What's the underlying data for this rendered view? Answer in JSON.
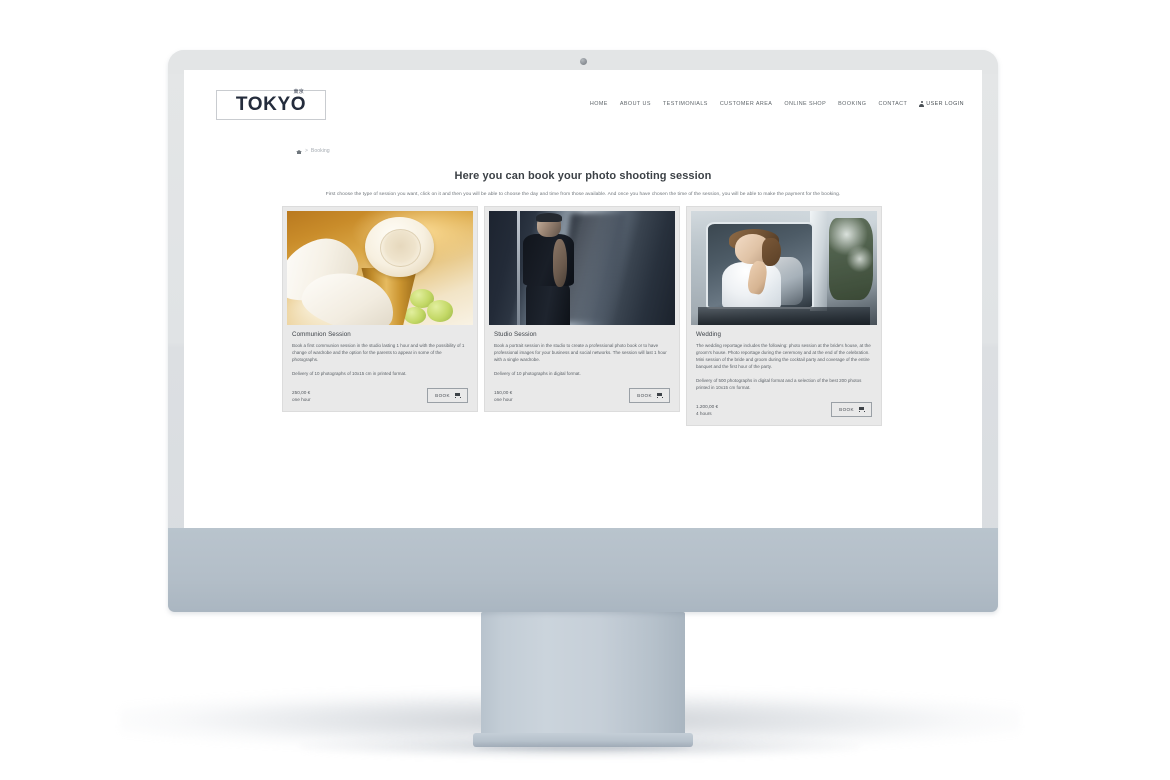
{
  "site": {
    "logo_text": "TOKYO",
    "logo_sub": "東京"
  },
  "nav": {
    "items": [
      {
        "label": "HOME"
      },
      {
        "label": "ABOUT US"
      },
      {
        "label": "TESTIMONIALS"
      },
      {
        "label": "CUSTOMER AREA"
      },
      {
        "label": "ONLINE SHOP"
      },
      {
        "label": "BOOKING"
      },
      {
        "label": "CONTACT"
      },
      {
        "label": "USER LOGIN"
      }
    ]
  },
  "breadcrumb": {
    "separator": ">",
    "current": "Booking"
  },
  "page": {
    "title": "Here you can book your photo shooting session",
    "subtitle": "First choose the type of session you want, click on it and then you will be able to choose the day and time from those available. And once you have chosen the time of the session, you will be able to make the payment for the booking."
  },
  "cards": [
    {
      "title": "Communion Session",
      "description": "Book a first communion session in the studio lasting 1 hour and with the possibility of 1 change of wardrobe and the option for the parents to appear in some of the photographs.",
      "delivery": "Delivery of 10 photographs of 10x15 cm in printed format.",
      "price": "250,00 €",
      "duration": "one hour",
      "button_label": "BOOK",
      "image_alt": "communion-host-chalice-lilies-photo"
    },
    {
      "title": "Studio Session",
      "description": "Book a portrait session in the studio to create a professional photo book or to have professional images for your business and social networks. The session will last 1 hour with a single wardrobe.",
      "delivery": "Delivery of 10 photographs in digital format.",
      "price": "150,00 €",
      "duration": "one hour",
      "button_label": "BOOK",
      "image_alt": "studio-portrait-man-shadow-photo"
    },
    {
      "title": "Wedding",
      "description": "The wedding reportage includes the following: photo session at the bride's house, at the groom's house. Photo reportage during the ceremony and at the end of the celebration. Mini session of the bride and groom during the cocktail party and coverage of the entire banquet and the first hour of the party.",
      "delivery": "Delivery of 500 photographs in digital format and a selection of the best 200 photos printed in 10x15 cm format.",
      "price": "1.200,00 €",
      "duration": "4 hours",
      "button_label": "BOOK",
      "image_alt": "bride-in-car-window-photo"
    }
  ],
  "colors": {
    "logo": "#242c3c",
    "nav_text": "#5e6469",
    "card_bg": "#e9e9e9",
    "monitor_bezel": "#e2e5e7",
    "monitor_chin": "#b3bec8",
    "stand": "#c3cdd6"
  }
}
